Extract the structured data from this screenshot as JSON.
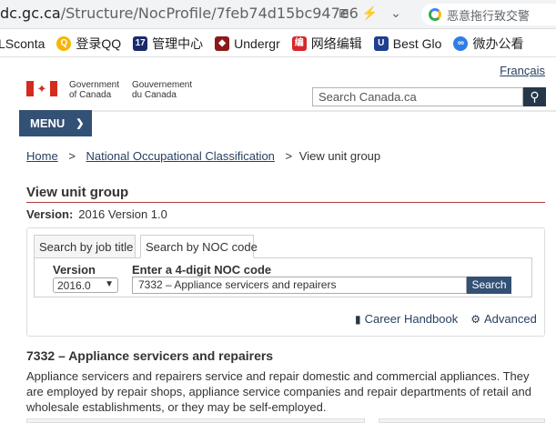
{
  "browser": {
    "url_host": "dc.gc.ca",
    "url_path": "/Structure/NocProfile/7feb74d15bc947e6",
    "omnibox_text": "恶意拖行致交警",
    "bookmarks": [
      "LSconta",
      "登录QQ",
      "管理中心",
      "Undergr",
      "网络编辑",
      "Best Glo",
      "微办公看"
    ]
  },
  "header": {
    "lang_link": "Français",
    "gov_en_1": "Government",
    "gov_en_2": "of Canada",
    "gov_fr_1": "Gouvernement",
    "gov_fr_2": "du Canada",
    "search_placeholder": "Search Canada.ca",
    "menu_label": "MENU"
  },
  "breadcrumb": {
    "items": [
      "Home",
      "National Occupational Classification",
      "View unit group"
    ]
  },
  "main": {
    "title": "View unit group",
    "version_label": "Version:",
    "version_value": "2016 Version 1.0",
    "tabs": [
      "Search by job title",
      "Search by NOC code"
    ],
    "version_field_label": "Version",
    "version_select_value": "2016.0",
    "code_field_label": "Enter a 4-digit NOC code",
    "code_input_value": "7332 – Appliance servicers and repairers",
    "search_button": "Search",
    "link_career": "Career Handbook",
    "link_advanced": "Advanced",
    "unit_group_title": "7332 – Appliance servicers and repairers",
    "description": "Appliance servicers and repairers service and repair domestic and commercial appliances. They are employed by repair shops, appliance service companies and repair departments of retail and wholesale establishments, or they may be self-employed."
  }
}
